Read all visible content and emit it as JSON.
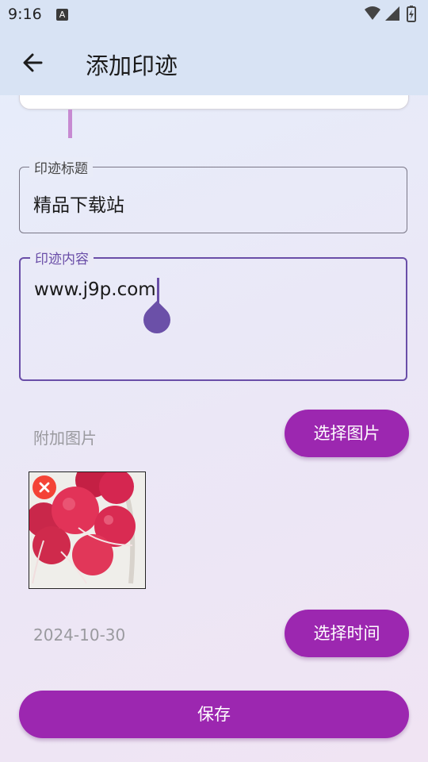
{
  "status_bar": {
    "time": "9:16",
    "icons": [
      "notification-a-icon",
      "wifi-icon",
      "signal-icon",
      "battery-charging-icon"
    ]
  },
  "app_bar": {
    "title": "添加印迹",
    "back_icon": "arrow-back-icon"
  },
  "form": {
    "title_field": {
      "label": "印迹标题",
      "value": "精品下载站"
    },
    "content_field": {
      "label": "印迹内容",
      "value": "www.j9p.com"
    }
  },
  "image_section": {
    "label": "附加图片",
    "select_button": "选择图片",
    "remove_icon": "close-icon"
  },
  "time_section": {
    "date": "2024-10-30",
    "select_button": "选择时间"
  },
  "save_button": "保存",
  "colors": {
    "primary": "#9c27b0",
    "focus": "#6a4ea8",
    "app_bar": "#d8e3f4",
    "remove": "#f44336"
  }
}
